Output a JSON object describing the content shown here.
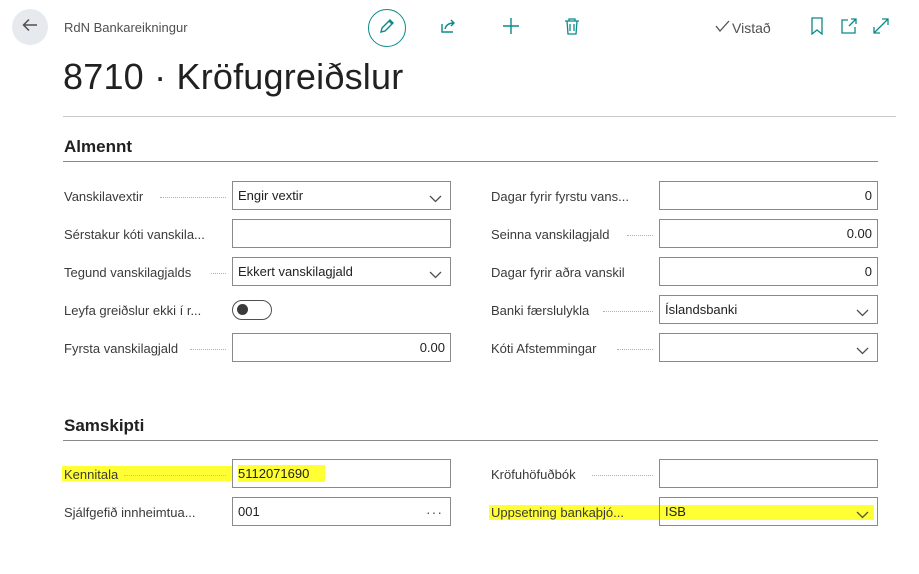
{
  "header": {
    "breadcrumb": "RdN Bankareikningur",
    "title": "8710 · Kröfugreiðslur",
    "saved_label": "Vistað"
  },
  "sections": {
    "general": {
      "title": "Almennt",
      "fields": {
        "interest": {
          "label": "Vanskilavextir",
          "value": "Engir vextir"
        },
        "special_code": {
          "label": "Sérstakur kóti vanskila...",
          "value": ""
        },
        "fee_type": {
          "label": "Tegund vanskilagjalds",
          "value": "Ekkert vanskilagjald"
        },
        "allow_payment": {
          "label": "Leyfa greiðslur ekki í r...",
          "value": false
        },
        "first_fee": {
          "label": "Fyrsta vanskilagjald",
          "value": "0.00"
        },
        "days_first": {
          "label": "Dagar fyrir fyrstu vans...",
          "value": "0"
        },
        "later_fee": {
          "label": "Seinna vanskilagjald",
          "value": "0.00"
        },
        "days_second": {
          "label": "Dagar fyrir aðra vanskil",
          "value": "0"
        },
        "bank_key": {
          "label": "Banki færslulykla",
          "value": "Íslandsbanki"
        },
        "recon_code": {
          "label": "Kóti Afstemmingar",
          "value": ""
        }
      }
    },
    "comm": {
      "title": "Samskipti",
      "fields": {
        "kennitala": {
          "label": "Kennitala",
          "value": "5112071690"
        },
        "default_collector": {
          "label": "Sjálfgefið innheimtua...",
          "value": "001"
        },
        "claim_ledger": {
          "label": "Kröfuhöfuðbók",
          "value": ""
        },
        "bank_service": {
          "label": "Uppsetning bankaþjó...",
          "value": "ISB"
        }
      }
    }
  },
  "colors": {
    "accent": "#0b8a8a",
    "highlight": "#ffff33"
  }
}
